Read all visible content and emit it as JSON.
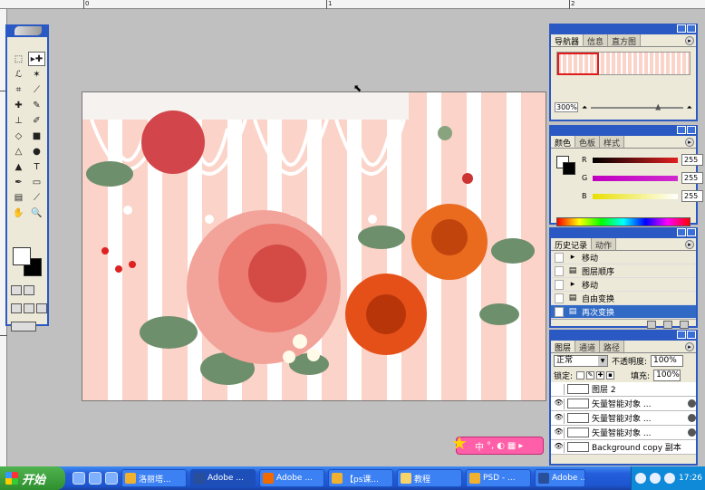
{
  "ruler": {
    "top_marks": [
      "0",
      "1",
      "2"
    ]
  },
  "navigator": {
    "tabs": [
      "导航器",
      "信息",
      "直方图"
    ],
    "zoom": "300%"
  },
  "color": {
    "tabs": [
      "颜色",
      "色板",
      "样式"
    ],
    "channels": [
      {
        "label": "R",
        "value": "255",
        "color": "#e02020"
      },
      {
        "label": "G",
        "value": "255",
        "color": "#d02ad0"
      },
      {
        "label": "B",
        "value": "255",
        "color": "#e8e000"
      }
    ]
  },
  "history": {
    "tabs": [
      "历史记录",
      "动作"
    ],
    "items": [
      {
        "label": "移动",
        "icon": "move-icon",
        "selected": false
      },
      {
        "label": "图层顺序",
        "icon": "document-icon",
        "selected": false
      },
      {
        "label": "移动",
        "icon": "move-icon",
        "selected": false
      },
      {
        "label": "自由变换",
        "icon": "document-icon",
        "selected": false
      },
      {
        "label": "再次变换",
        "icon": "document-icon",
        "selected": true
      }
    ]
  },
  "layers": {
    "tabs": [
      "图层",
      "通道",
      "路径"
    ],
    "blend_mode": "正常",
    "opacity_label": "不透明度:",
    "opacity": "100%",
    "lock_label": "锁定:",
    "fill_label": "填充:",
    "fill": "100%",
    "items": [
      {
        "name": "图层 2",
        "visible": false
      },
      {
        "name": "矢量智能对象 ...",
        "visible": true
      },
      {
        "name": "矢量智能对象 ...",
        "visible": true
      },
      {
        "name": "矢量智能对象 ...",
        "visible": true
      },
      {
        "name": "Background copy 副本",
        "visible": true
      }
    ]
  },
  "ime": {
    "label": "中"
  },
  "taskbar": {
    "start_label": "开始",
    "tasks": [
      {
        "label": "洛丽塔...",
        "icon_color": "#f0b030"
      },
      {
        "label": "Adobe ...",
        "icon_color": "#2a4f9a"
      },
      {
        "label": "Adobe ...",
        "icon_color": "#f06a00"
      },
      {
        "label": "【ps课...",
        "icon_color": "#f0b030"
      },
      {
        "label": "教程",
        "icon_color": "#f7d36b"
      },
      {
        "label": "PSD - ...",
        "icon_color": "#f0b030"
      },
      {
        "label": "Adobe ...",
        "icon_color": "#2a4f9a"
      }
    ],
    "clock": "17:26"
  }
}
